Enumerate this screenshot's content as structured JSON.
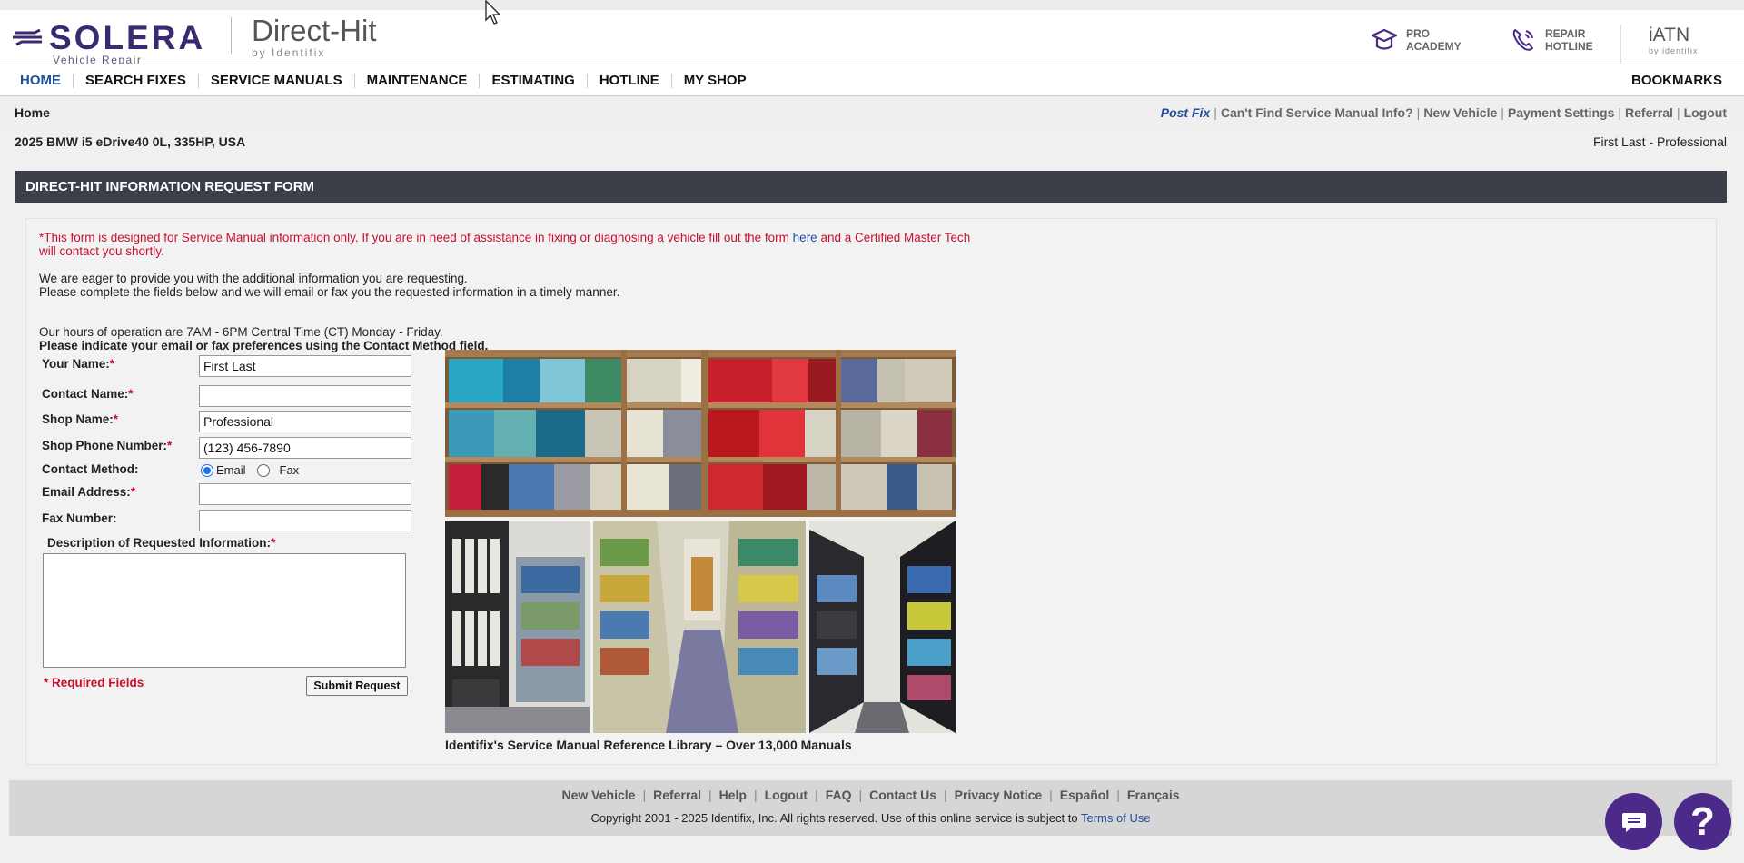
{
  "header": {
    "solera_word": "SOLERA",
    "solera_sub": "Vehicle Repair",
    "directhit_word": "Direct-Hit",
    "directhit_sub": "by Identifix",
    "pro_academy_label": "PRO\nACADEMY",
    "repair_hotline_label": "REPAIR\nHOTLINE",
    "iatn_label": "iATN",
    "iatn_sub": "by identifix",
    "brand_color": "#3b2a72"
  },
  "nav": {
    "items": [
      {
        "label": "HOME",
        "active": true
      },
      {
        "label": "SEARCH FIXES"
      },
      {
        "label": "SERVICE MANUALS"
      },
      {
        "label": "MAINTENANCE"
      },
      {
        "label": "ESTIMATING"
      },
      {
        "label": "HOTLINE"
      },
      {
        "label": "MY SHOP"
      }
    ],
    "bookmarks": "BOOKMARKS"
  },
  "subbar": {
    "breadcrumb": "Home",
    "links": [
      "Post Fix",
      "Can't Find Service Manual Info?",
      "New Vehicle",
      "Payment Settings",
      "Referral",
      "Logout"
    ],
    "vehicle": "2025 BMW i5 eDrive40 0L, 335HP, USA",
    "user": "First Last - Professional"
  },
  "form": {
    "title": "DIRECT-HIT INFORMATION REQUEST FORM",
    "notice_before": "*This form is designed for Service Manual information only. If you are in need of assistance in fixing or diagnosing a vehicle fill out the form ",
    "notice_link": "here",
    "notice_after": " and a Certified Master Tech will contact you shortly.",
    "intro1": "We are eager to provide you with the additional information you are requesting.",
    "intro2": "Please complete the fields below and we will email or fax you the requested information in a timely manner.",
    "hours": "Our hours of operation are 7AM - 6PM Central Time (CT) Monday - Friday.",
    "pref_note": "Please indicate your email or fax preferences using the Contact Method field.",
    "fields": {
      "your_name": {
        "label": "Your Name:",
        "value": "First Last"
      },
      "contact_name": {
        "label": "Contact Name:",
        "value": ""
      },
      "shop_name": {
        "label": "Shop Name:",
        "value": "Professional"
      },
      "shop_phone": {
        "label": "Shop Phone Number:",
        "value": "(123) 456-7890"
      },
      "contact_method": {
        "label": "Contact Method:",
        "options": [
          "Email",
          "Fax"
        ],
        "selected": "Email"
      },
      "email": {
        "label": "Email Address:",
        "value": ""
      },
      "fax": {
        "label": "Fax Number:",
        "value": ""
      },
      "description": {
        "label": "Description of Requested Information:",
        "value": ""
      }
    },
    "required_star": "*",
    "required_note": "* Required Fields",
    "submit_label": "Submit Request",
    "caption": "Identifix's Service Manual Reference Library – Over 13,000 Manuals"
  },
  "footer": {
    "links": [
      "New Vehicle",
      "Referral",
      "Help",
      "Logout",
      "FAQ",
      "Contact Us",
      "Privacy Notice",
      "Español",
      "Français"
    ],
    "copyright": "Copyright 2001 - 2025 Identifix, Inc. All rights reserved. Use of this online service is subject to ",
    "terms_link": "Terms of Use"
  },
  "icons": {
    "chat": "chat-bubble-icon",
    "help": "question-mark-icon",
    "help_glyph": "?",
    "pro_academy": "graduation-cap-icon",
    "repair_hotline": "phone-icon"
  },
  "colors": {
    "accent_blue": "#1f4e9c",
    "required_red": "#c8102e",
    "form_title_bg": "#3c3f48",
    "fab_purple": "#4b2a8a"
  }
}
